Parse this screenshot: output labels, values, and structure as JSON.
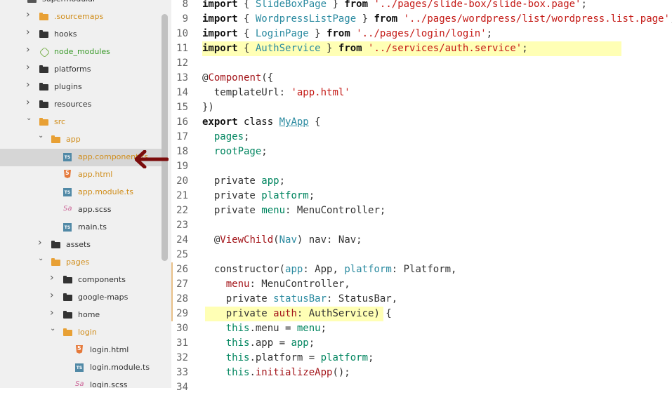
{
  "sidebar": {
    "items": [
      {
        "label": "supermodular",
        "kind": "folder",
        "open": true,
        "indent": 0,
        "color": "#555"
      },
      {
        "label": ".sourcemaps",
        "kind": "folder",
        "open": false,
        "indent": 1,
        "color": "#e8a034",
        "labelColor": "#d08d1a"
      },
      {
        "label": "hooks",
        "kind": "folder",
        "open": false,
        "indent": 1,
        "color": "#333"
      },
      {
        "label": "node_modules",
        "kind": "node",
        "open": false,
        "indent": 1,
        "labelColor": "#3a9a2a"
      },
      {
        "label": "platforms",
        "kind": "folder",
        "open": false,
        "indent": 1,
        "color": "#333"
      },
      {
        "label": "plugins",
        "kind": "folder",
        "open": false,
        "indent": 1,
        "color": "#333"
      },
      {
        "label": "resources",
        "kind": "folder",
        "open": false,
        "indent": 1,
        "color": "#333"
      },
      {
        "label": "src",
        "kind": "folder",
        "open": true,
        "indent": 1,
        "color": "#e8a034",
        "labelColor": "#d08d1a"
      },
      {
        "label": "app",
        "kind": "folder",
        "open": true,
        "indent": 2,
        "color": "#e8a034",
        "labelColor": "#d08d1a"
      },
      {
        "label": "app.component.ts",
        "kind": "ts",
        "indent": 3,
        "labelColor": "#d08d1a",
        "selected": true
      },
      {
        "label": "app.html",
        "kind": "html",
        "indent": 3,
        "labelColor": "#d08d1a"
      },
      {
        "label": "app.module.ts",
        "kind": "ts",
        "indent": 3,
        "labelColor": "#d08d1a"
      },
      {
        "label": "app.scss",
        "kind": "scss",
        "indent": 3,
        "labelColor": "#333"
      },
      {
        "label": "main.ts",
        "kind": "ts",
        "indent": 3,
        "labelColor": "#333"
      },
      {
        "label": "assets",
        "kind": "folder",
        "open": false,
        "indent": 2,
        "color": "#333"
      },
      {
        "label": "pages",
        "kind": "folder",
        "open": true,
        "indent": 2,
        "color": "#e8a034",
        "labelColor": "#d08d1a"
      },
      {
        "label": "components",
        "kind": "folder",
        "open": false,
        "indent": 3,
        "color": "#333"
      },
      {
        "label": "google-maps",
        "kind": "folder",
        "open": false,
        "indent": 3,
        "color": "#333"
      },
      {
        "label": "home",
        "kind": "folder",
        "open": false,
        "indent": 3,
        "color": "#333"
      },
      {
        "label": "login",
        "kind": "folder",
        "open": true,
        "indent": 3,
        "color": "#e8a034",
        "labelColor": "#d08d1a"
      },
      {
        "label": "login.html",
        "kind": "html",
        "indent": 4,
        "labelColor": "#333"
      },
      {
        "label": "login.module.ts",
        "kind": "ts",
        "indent": 4,
        "labelColor": "#333"
      },
      {
        "label": "login.scss",
        "kind": "scss",
        "indent": 4,
        "labelColor": "#333"
      }
    ]
  },
  "editor": {
    "lines": [
      {
        "n": "8",
        "tokens": [
          [
            "kw",
            "import"
          ],
          [
            "",
            "{ "
          ],
          [
            "cls",
            "SlideBoxPage"
          ],
          [
            "",
            " } "
          ],
          [
            "kw",
            "from"
          ],
          [
            "",
            " "
          ],
          [
            "str",
            "'../pages/slide-box/slide-box.page'"
          ],
          [
            "",
            ";"
          ]
        ]
      },
      {
        "n": "9",
        "tokens": [
          [
            "kw",
            "import"
          ],
          [
            "",
            "{ "
          ],
          [
            "cls",
            "WordpressListPage"
          ],
          [
            "",
            " } "
          ],
          [
            "kw",
            "from"
          ],
          [
            "",
            " "
          ],
          [
            "str",
            "'../pages/wordpress/list/wordpress.list.page'"
          ],
          [
            "",
            ";"
          ]
        ]
      },
      {
        "n": "10",
        "tokens": [
          [
            "kw",
            "import"
          ],
          [
            "",
            "{ "
          ],
          [
            "cls",
            "LoginPage"
          ],
          [
            "",
            " } "
          ],
          [
            "kw",
            "from"
          ],
          [
            "",
            " "
          ],
          [
            "str",
            "'../pages/login/login'"
          ],
          [
            "",
            ";"
          ]
        ]
      },
      {
        "n": "11",
        "tokens": [
          [
            "kw",
            "import"
          ],
          [
            "",
            "{ "
          ],
          [
            "cls",
            "AuthService"
          ],
          [
            "",
            " } "
          ],
          [
            "kw",
            "from"
          ],
          [
            "",
            " "
          ],
          [
            "str",
            "'../services/auth.service'"
          ],
          [
            "",
            ";"
          ]
        ],
        "highlight": true
      },
      {
        "n": "12",
        "tokens": []
      },
      {
        "n": "13",
        "tokens": [
          [
            "",
            "@"
          ],
          [
            "dec",
            "Component"
          ],
          [
            "",
            "({"
          ]
        ]
      },
      {
        "n": "14",
        "tokens": [
          [
            "",
            "  templateUrl: "
          ],
          [
            "str",
            "'app.html'"
          ]
        ]
      },
      {
        "n": "15",
        "tokens": [
          [
            "",
            "})"
          ]
        ]
      },
      {
        "n": "16",
        "tokens": [
          [
            "kw",
            "export"
          ],
          [
            "kw2",
            " class "
          ],
          [
            "cls ul",
            "MyApp"
          ],
          [
            "",
            " {"
          ]
        ]
      },
      {
        "n": "17",
        "tokens": [
          [
            "prop",
            "  pages"
          ],
          [
            "",
            ";"
          ]
        ]
      },
      {
        "n": "18",
        "tokens": [
          [
            "prop",
            "  rootPage"
          ],
          [
            "",
            ";"
          ]
        ]
      },
      {
        "n": "19",
        "tokens": []
      },
      {
        "n": "20",
        "tokens": [
          [
            "",
            "  private "
          ],
          [
            "prop",
            "app"
          ],
          [
            "",
            ";"
          ]
        ]
      },
      {
        "n": "21",
        "tokens": [
          [
            "",
            "  private "
          ],
          [
            "prop",
            "platform"
          ],
          [
            "",
            ";"
          ]
        ]
      },
      {
        "n": "22",
        "tokens": [
          [
            "",
            "  private "
          ],
          [
            "prop",
            "menu"
          ],
          [
            "",
            ": MenuController;"
          ]
        ]
      },
      {
        "n": "23",
        "tokens": []
      },
      {
        "n": "24",
        "tokens": [
          [
            "",
            "  @"
          ],
          [
            "dec",
            "ViewChild"
          ],
          [
            "",
            "("
          ],
          [
            "cls",
            "Nav"
          ],
          [
            "",
            ") nav: Nav;"
          ]
        ]
      },
      {
        "n": "25",
        "tokens": []
      },
      {
        "n": "26",
        "tokens": [
          [
            "",
            "  constructor("
          ],
          [
            "cls",
            "app"
          ],
          [
            "",
            ": App, "
          ],
          [
            "cls",
            "platform"
          ],
          [
            "",
            ": Platform,"
          ]
        ]
      },
      {
        "n": "27",
        "tokens": [
          [
            "",
            "    "
          ],
          [
            "dec",
            "menu"
          ],
          [
            "",
            ": MenuController,"
          ]
        ]
      },
      {
        "n": "28",
        "tokens": [
          [
            "",
            "    private "
          ],
          [
            "cls",
            "statusBar"
          ],
          [
            "",
            ": StatusBar,"
          ]
        ]
      },
      {
        "n": "29",
        "tokens": [
          [
            "",
            "    private "
          ],
          [
            "dec",
            "auth"
          ],
          [
            "",
            ": AuthService) {"
          ]
        ],
        "highlight": true
      },
      {
        "n": "30",
        "tokens": [
          [
            "prop",
            "    this"
          ],
          [
            "",
            ".menu = "
          ],
          [
            "prop",
            "menu"
          ],
          [
            "",
            ";"
          ]
        ]
      },
      {
        "n": "31",
        "tokens": [
          [
            "prop",
            "    this"
          ],
          [
            "",
            ".app = "
          ],
          [
            "prop",
            "app"
          ],
          [
            "",
            ";"
          ]
        ]
      },
      {
        "n": "32",
        "tokens": [
          [
            "prop",
            "    this"
          ],
          [
            "",
            ".platform = "
          ],
          [
            "prop",
            "platform"
          ],
          [
            "",
            ";"
          ]
        ]
      },
      {
        "n": "33",
        "tokens": [
          [
            "prop",
            "    this"
          ],
          [
            "",
            "."
          ],
          [
            "dec",
            "initializeApp"
          ],
          [
            "",
            "();"
          ]
        ]
      },
      {
        "n": "34",
        "tokens": []
      }
    ]
  },
  "annotation": {
    "icon": "left-arrow-icon",
    "color": "#7b0c0c"
  }
}
